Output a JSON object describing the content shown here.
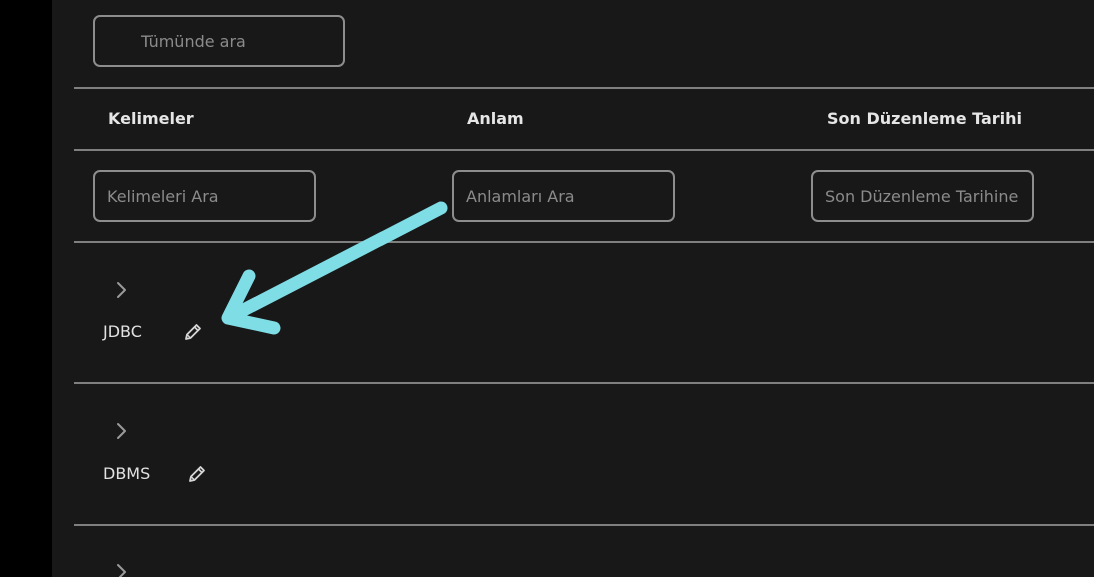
{
  "search": {
    "global_placeholder": "Tümünde ara"
  },
  "table": {
    "headers": {
      "words": "Kelimeler",
      "meaning": "Anlam",
      "last_edit": "Son Düzenleme Tarihi"
    },
    "filters": {
      "words_placeholder": "Kelimeleri Ara",
      "meaning_placeholder": "Anlamları Ara",
      "last_edit_placeholder": "Son Düzenleme Tarihine"
    },
    "rows": [
      {
        "word": "JDBC"
      },
      {
        "word": "DBMS"
      }
    ]
  },
  "icons": {
    "expand": "chevron-right-icon",
    "edit": "pencil-icon",
    "annotation": "arrow-annotation"
  },
  "colors": {
    "background": "#181818",
    "annotation_arrow": "#7fdde6",
    "border": "#8d8d8d",
    "text": "#e6e6e6"
  }
}
